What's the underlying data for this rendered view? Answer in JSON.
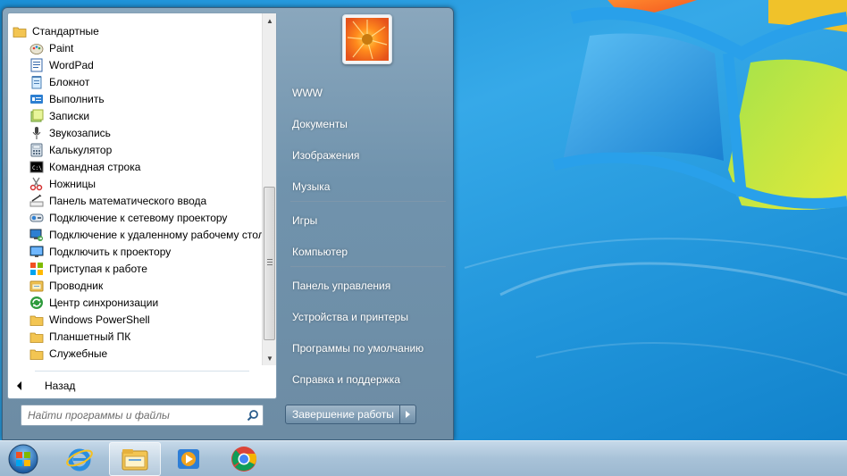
{
  "start_menu": {
    "programs": [
      {
        "label": "Стандартные",
        "icon": "folder-icon",
        "top": true
      },
      {
        "label": "Paint",
        "icon": "paint-icon"
      },
      {
        "label": "WordPad",
        "icon": "wordpad-icon"
      },
      {
        "label": "Блокнот",
        "icon": "notepad-icon"
      },
      {
        "label": "Выполнить",
        "icon": "run-icon"
      },
      {
        "label": "Записки",
        "icon": "sticky-notes-icon"
      },
      {
        "label": "Звукозапись",
        "icon": "microphone-icon"
      },
      {
        "label": "Калькулятор",
        "icon": "calculator-icon"
      },
      {
        "label": "Командная строка",
        "icon": "command-prompt-icon"
      },
      {
        "label": "Ножницы",
        "icon": "scissors-icon"
      },
      {
        "label": "Панель математического ввода",
        "icon": "math-input-icon"
      },
      {
        "label": "Подключение к сетевому проектору",
        "icon": "network-projector-icon"
      },
      {
        "label": "Подключение к удаленному рабочему столу",
        "icon": "remote-desktop-icon"
      },
      {
        "label": "Подключить к проектору",
        "icon": "projector-icon"
      },
      {
        "label": "Приступая к работе",
        "icon": "getting-started-icon"
      },
      {
        "label": "Проводник",
        "icon": "explorer-icon"
      },
      {
        "label": "Центр синхронизации",
        "icon": "sync-center-icon"
      },
      {
        "label": "Windows PowerShell",
        "icon": "folder-icon"
      },
      {
        "label": "Планшетный ПК",
        "icon": "folder-icon"
      },
      {
        "label": "Служебные",
        "icon": "folder-icon"
      }
    ],
    "back_label": "Назад",
    "search_placeholder": "Найти программы и файлы",
    "right_links": [
      "WWW",
      "Документы",
      "Изображения",
      "Музыка",
      "Игры",
      "Компьютер",
      "Панель управления",
      "Устройства и принтеры",
      "Программы по умолчанию",
      "Справка и поддержка"
    ],
    "shutdown_label": "Завершение работы"
  },
  "taskbar": {
    "items": [
      "start-orb-icon",
      "internet-explorer-icon",
      "windows-explorer-icon",
      "media-player-icon",
      "chrome-icon"
    ]
  },
  "colors": {
    "desktop": "#1f93d9",
    "menu_right": "#7093ad",
    "taskbar": "#a8c2d8"
  }
}
